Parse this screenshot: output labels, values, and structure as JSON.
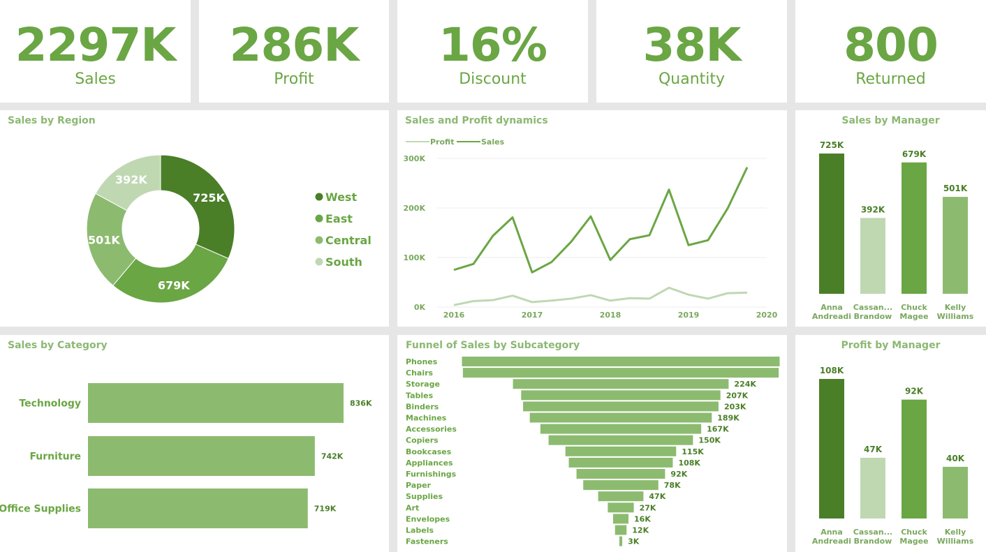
{
  "kpis": [
    {
      "value": "2297K",
      "label": "Sales"
    },
    {
      "value": "286K",
      "label": "Profit"
    },
    {
      "value": "16%",
      "label": "Discount"
    },
    {
      "value": "38K",
      "label": "Quantity"
    },
    {
      "value": "800",
      "label": "Returned"
    }
  ],
  "colors": {
    "dark": "#4a7f28",
    "mid": "#6aa644",
    "light": "#8cbb70",
    "pale": "#bfd8b2",
    "text": "#6aa644",
    "title": "#8cb873",
    "axis": "#7aa85e"
  },
  "chart_data": [
    {
      "id": "region",
      "type": "pie",
      "title": "Sales by Region",
      "categories": [
        "West",
        "East",
        "Central",
        "South"
      ],
      "values": [
        725,
        679,
        501,
        392
      ],
      "labels": [
        "725K",
        "679K",
        "501K",
        "392K"
      ],
      "legend": "right"
    },
    {
      "id": "dynamics",
      "type": "line",
      "title": "Sales and Profit dynamics",
      "x": [
        2016.0,
        2016.25,
        2016.5,
        2016.75,
        2017.0,
        2017.25,
        2017.5,
        2017.75,
        2018.0,
        2018.25,
        2018.5,
        2018.75,
        2019.0,
        2019.25,
        2019.5,
        2019.75
      ],
      "series": [
        {
          "name": "Profit",
          "values": [
            4,
            12,
            14,
            23,
            10,
            13,
            17,
            24,
            13,
            18,
            17,
            39,
            25,
            17,
            28,
            29
          ]
        },
        {
          "name": "Sales",
          "values": [
            75,
            87,
            144,
            181,
            70,
            91,
            132,
            183,
            95,
            137,
            145,
            237,
            125,
            135,
            199,
            282
          ]
        }
      ],
      "yticks": [
        "0K",
        "100K",
        "200K",
        "300K"
      ],
      "xticks": [
        "2016",
        "2017",
        "2018",
        "2019",
        "2020"
      ],
      "ylim": [
        0,
        300
      ],
      "xlim": [
        2016,
        2020
      ],
      "legend": "top-left"
    },
    {
      "id": "sales_manager",
      "type": "bar",
      "title": "Sales by Manager",
      "categories": [
        [
          "Anna",
          "Andreadi"
        ],
        [
          "Cassan...",
          "Brandow"
        ],
        [
          "Chuck",
          "Magee"
        ],
        [
          "Kelly",
          "Williams"
        ]
      ],
      "values": [
        725,
        392,
        679,
        501
      ],
      "labels": [
        "725K",
        "392K",
        "679K",
        "501K"
      ]
    },
    {
      "id": "category",
      "type": "bar",
      "title": "Sales by Category",
      "categories": [
        "Technology",
        "Furniture",
        "Office Supplies"
      ],
      "values": [
        836,
        742,
        719
      ],
      "labels": [
        "836K",
        "742K",
        "719K"
      ]
    },
    {
      "id": "funnel",
      "type": "bar",
      "title": "Funnel of Sales by Subcategory",
      "categories": [
        "Phones",
        "Chairs",
        "Storage",
        "Tables",
        "Binders",
        "Machines",
        "Accessories",
        "Copiers",
        "Bookcases",
        "Appliances",
        "Furnishings",
        "Paper",
        "Supplies",
        "Art",
        "Envelopes",
        "Labels",
        "Fasteners"
      ],
      "values": [
        330,
        328,
        224,
        207,
        203,
        189,
        167,
        150,
        115,
        108,
        92,
        78,
        47,
        27,
        16,
        12,
        3
      ],
      "labels": [
        "",
        "",
        "224K",
        "207K",
        "203K",
        "189K",
        "167K",
        "150K",
        "115K",
        "108K",
        "92K",
        "78K",
        "47K",
        "27K",
        "16K",
        "12K",
        "3K"
      ]
    },
    {
      "id": "profit_manager",
      "type": "bar",
      "title": "Profit by Manager",
      "categories": [
        [
          "Anna",
          "Andreadi"
        ],
        [
          "Cassan...",
          "Brandow"
        ],
        [
          "Chuck",
          "Magee"
        ],
        [
          "Kelly",
          "Williams"
        ]
      ],
      "values": [
        108,
        47,
        92,
        40
      ],
      "labels": [
        "108K",
        "47K",
        "92K",
        "40K"
      ]
    }
  ]
}
